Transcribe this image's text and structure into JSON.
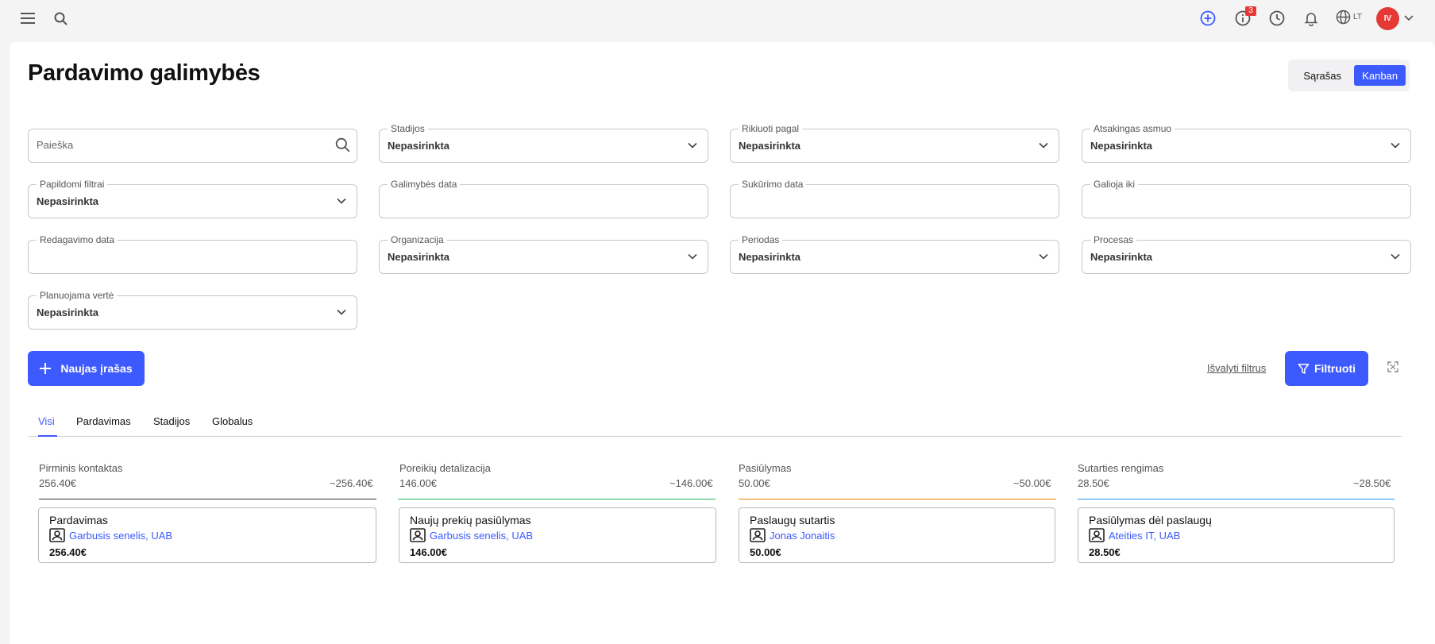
{
  "topbar": {
    "notifications_badge": "3",
    "language": "LT",
    "avatar_initials": "IV"
  },
  "page": {
    "title": "Pardavimo galimybės"
  },
  "view_toggle": {
    "list": "Sąrašas",
    "kanban": "Kanban",
    "active": "kanban"
  },
  "filters": {
    "search": {
      "placeholder": "Paieška"
    },
    "stages": {
      "label": "Stadijos",
      "value": "Nepasirinkta"
    },
    "sort_by": {
      "label": "Rikiuoti pagal",
      "value": "Nepasirinkta"
    },
    "responsible": {
      "label": "Atsakingas asmuo",
      "value": "Nepasirinkta"
    },
    "extra_filters": {
      "label": "Papildomi filtrai",
      "value": "Nepasirinkta"
    },
    "opportunity_date": {
      "label": "Galimybės data",
      "value": ""
    },
    "created_date": {
      "label": "Sukūrimo data",
      "value": ""
    },
    "valid_until": {
      "label": "Galioja iki",
      "value": ""
    },
    "edited_date": {
      "label": "Redagavimo data",
      "value": ""
    },
    "organization": {
      "label": "Organizacija",
      "value": "Nepasirinkta"
    },
    "period": {
      "label": "Periodas",
      "value": "Nepasirinkta"
    },
    "process": {
      "label": "Procesas",
      "value": "Nepasirinkta"
    },
    "planned_value": {
      "label": "Planuojama vertė",
      "value": "Nepasirinkta"
    }
  },
  "actions": {
    "new_record": "Naujas įrašas",
    "clear_filters": "Išvalyti filtrus",
    "filter": "Filtruoti"
  },
  "tabs": [
    {
      "label": "Visi",
      "active": true
    },
    {
      "label": "Pardavimas",
      "active": false
    },
    {
      "label": "Stadijos",
      "active": false
    },
    {
      "label": "Globalus",
      "active": false
    }
  ],
  "kanban": [
    {
      "name": "Pirminis kontaktas",
      "total": "256.40€",
      "estimate": "~256.40€",
      "color": "#333333",
      "cards": [
        {
          "title": "Pardavimas",
          "org": "Garbusis senelis, UAB",
          "value": "256.40€"
        }
      ]
    },
    {
      "name": "Poreikių detalizacija",
      "total": "146.00€",
      "estimate": "~146.00€",
      "color": "#1db954",
      "cards": [
        {
          "title": "Naujų prekių pasiūlymas",
          "org": "Garbusis senelis, UAB",
          "value": "146.00€"
        }
      ]
    },
    {
      "name": "Pasiūlymas",
      "total": "50.00€",
      "estimate": "~50.00€",
      "color": "#f57c00",
      "cards": [
        {
          "title": "Paslaugų sutartis",
          "org": "Jonas Jonaitis",
          "value": "50.00€"
        }
      ]
    },
    {
      "name": "Sutarties rengimas",
      "total": "28.50€",
      "estimate": "~28.50€",
      "color": "#2196f3",
      "cards": [
        {
          "title": "Pasiūlymas dėl paslaugų",
          "org": "Ateities IT, UAB",
          "value": "28.50€"
        }
      ]
    }
  ],
  "colors": {
    "accent": "#3d5afe",
    "badge": "#e53935"
  }
}
